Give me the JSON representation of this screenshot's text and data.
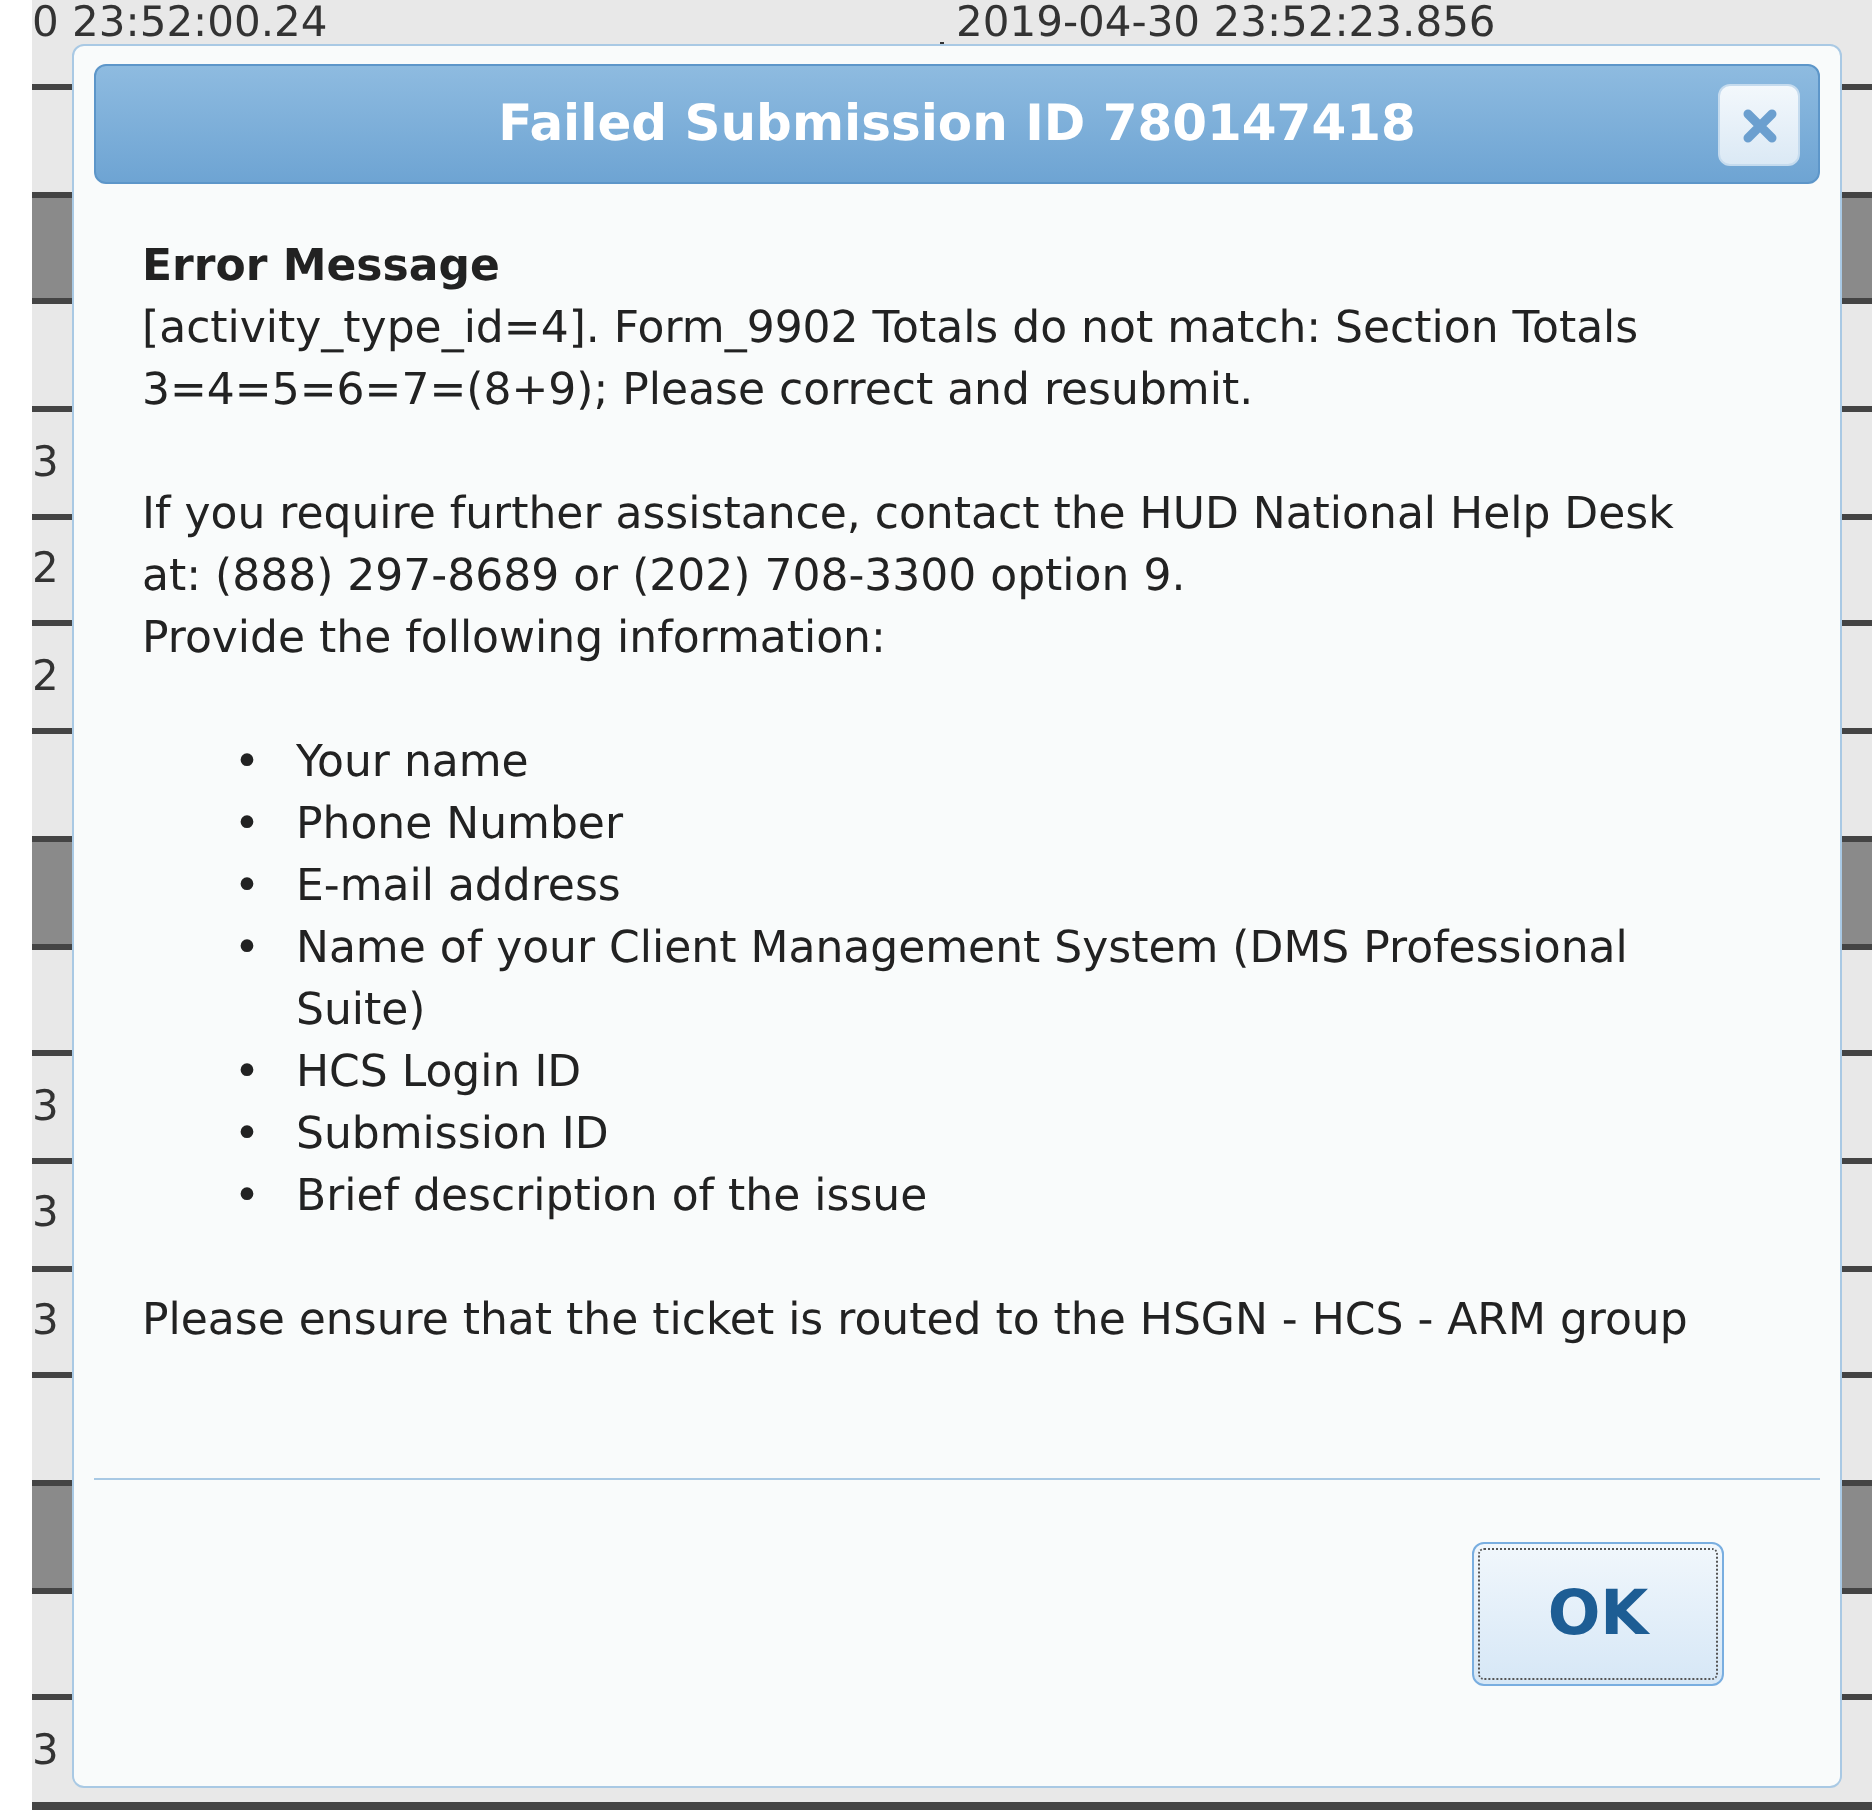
{
  "background_table": {
    "header": [
      "0 23:52:00.24",
      "2019-04-30 23:52:23.856"
    ],
    "rows": [
      {
        "kind": "row"
      },
      {
        "kind": "band"
      },
      {
        "kind": "row"
      },
      {
        "kind": "row",
        "cell": "3"
      },
      {
        "kind": "row",
        "cell": "2"
      },
      {
        "kind": "row",
        "cell": "2"
      },
      {
        "kind": "row"
      },
      {
        "kind": "band"
      },
      {
        "kind": "row"
      },
      {
        "kind": "row",
        "cell": "3"
      },
      {
        "kind": "row",
        "cell": "3"
      },
      {
        "kind": "row",
        "cell": "3"
      },
      {
        "kind": "row"
      },
      {
        "kind": "band"
      },
      {
        "kind": "row"
      },
      {
        "kind": "row",
        "cell": "3"
      }
    ]
  },
  "dialog": {
    "title": "Failed Submission ID 780147418",
    "heading": "Error Message",
    "message": "[activity_type_id=4]. Form_9902 Totals do not match: Section Totals 3=4=5=6=7=(8+9); Please correct and resubmit.",
    "help": [
      "If you require further assistance, contact the HUD National Help Desk at: (888) 297-8689 or (202) 708-3300 option 9.",
      "Provide the following information:"
    ],
    "bullet": "•",
    "items": [
      "Your name",
      "Phone Number",
      "E-mail address",
      "Name of your Client Management System (DMS Professional Suite)",
      "HCS Login ID",
      "Submission ID",
      "Brief description of the issue"
    ],
    "note": "Please ensure that the ticket is routed to the HSGN - HCS - ARM group",
    "buttons": [
      {
        "label": "OK",
        "focused": true
      }
    ]
  }
}
